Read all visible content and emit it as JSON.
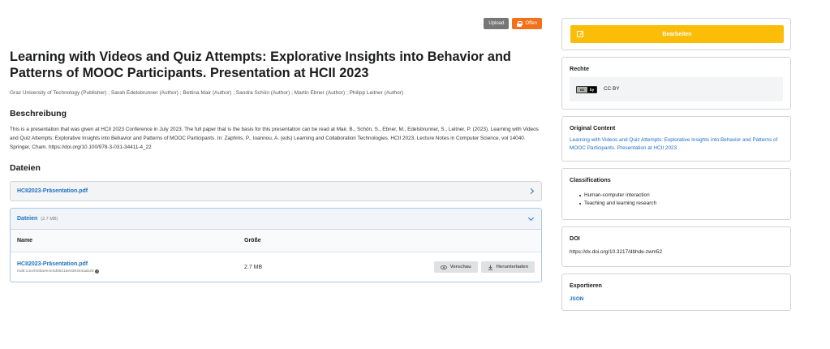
{
  "badges": {
    "upload": "Upload",
    "access": "Offen"
  },
  "record": {
    "title": "Learning with Videos and Quiz Attempts: Explorative Insights into Behavior and Patterns of MOOC Participants. Presentation at HCII 2023",
    "creators": "Graz University of Technology (Publisher) ; Sarah Edelsbrunner (Author) ; Bettina Mair (Author) ; Sandra Schön (Author) ; Martin Ebner (Author) ; Philipp Leitner (Author)"
  },
  "description": {
    "heading": "Beschreibung",
    "text": "This is a presentation that was given at HCII 2023 Conference in July 2023. The full paper that is the basis for this presentation can be read at Mair, B., Schön, S., Ebner, M., Edelsbrunner, S., Leitner, P. (2023). Learning with Videos and Quiz Attempts: Explorative Insights into Behavior and Patterns of MOOC Participants. In: Zaphiris, P., Ioannou, A. (eds) Learning and Collaboration Technologies. HCII 2023. Lecture Notes in Computer Science, vol 14040. Springer, Cham. https://doi.org/10.100/978-3-031-34411-4_22"
  },
  "files": {
    "heading": "Dateien",
    "preview_accordion": "HCII2023-Präsentation.pdf",
    "box_title": "Dateien",
    "box_size": "(2.7 MB)",
    "columns": {
      "name": "Name",
      "size": "Größe"
    },
    "rows": [
      {
        "name": "HCII2023-Präsentation.pdf",
        "md5": "md5:14cef405aee4e3d8621be0393e3aab28",
        "size": "2.7 MB",
        "preview_label": "Vorschau",
        "download_label": "Herunterladen"
      }
    ]
  },
  "sidebar": {
    "edit_label": "Bearbeiten",
    "rights": {
      "heading": "Rechte",
      "license_logo": "cc by",
      "license": "CC BY"
    },
    "original": {
      "heading": "Original Content",
      "link": "Learning with Videos and Quiz Attempts: Explorative Insights into Behavior and Patterns of MOOC Participants. Presentation at HCII 2023"
    },
    "classifications": {
      "heading": "Classifications",
      "items": [
        "Human-computer interaction",
        "Teaching and learning research"
      ]
    },
    "doi": {
      "heading": "DOI",
      "value": "https://dx.doi.org/10.3217/dbhde-zwm52"
    },
    "export": {
      "heading": "Exportieren",
      "format": "JSON"
    }
  },
  "colors": {
    "edit": "#fbbd08",
    "access": "#f2711c",
    "link": "#1e70bf"
  },
  "icons": {
    "access": "lock-icon",
    "edit": "pencil-icon",
    "preview": "eye-icon",
    "download": "download-icon",
    "expand": "chevron-right-icon",
    "collapse": "chevron-down-icon",
    "md5_help": "question-circle-icon"
  }
}
